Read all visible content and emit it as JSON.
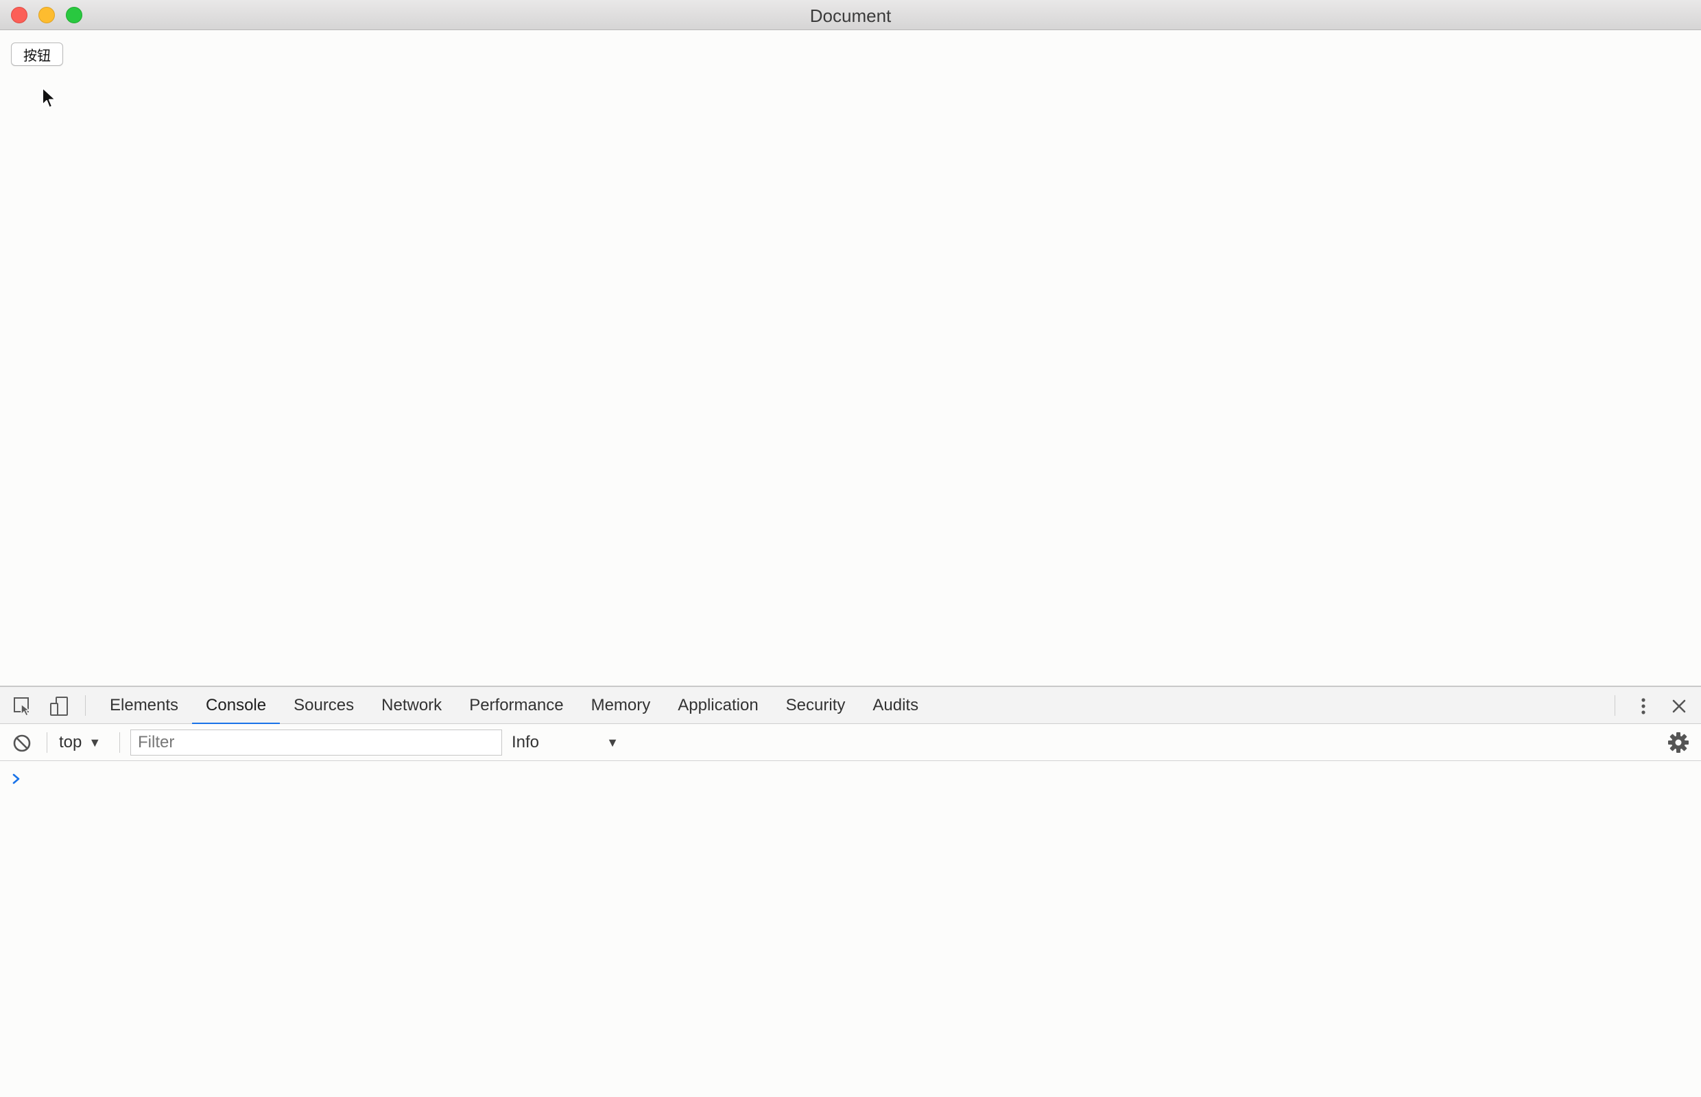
{
  "window": {
    "title": "Document"
  },
  "page": {
    "button_label": "按钮"
  },
  "devtools": {
    "tabs": [
      {
        "label": "Elements"
      },
      {
        "label": "Console",
        "active": true
      },
      {
        "label": "Sources"
      },
      {
        "label": "Network"
      },
      {
        "label": "Performance"
      },
      {
        "label": "Memory"
      },
      {
        "label": "Application"
      },
      {
        "label": "Security"
      },
      {
        "label": "Audits"
      }
    ],
    "console_toolbar": {
      "context": "top",
      "filter_placeholder": "Filter",
      "filter_value": "",
      "level": "Info"
    },
    "prompt_value": ""
  },
  "colors": {
    "accent": "#1a73e8",
    "prompt": "#1a73e8"
  },
  "icons": [
    "inspect-element-icon",
    "device-toolbar-icon",
    "more-vertical-icon",
    "close-icon",
    "clear-console-icon",
    "gear-icon",
    "prompt-chevron-icon",
    "mouse-cursor-icon"
  ]
}
